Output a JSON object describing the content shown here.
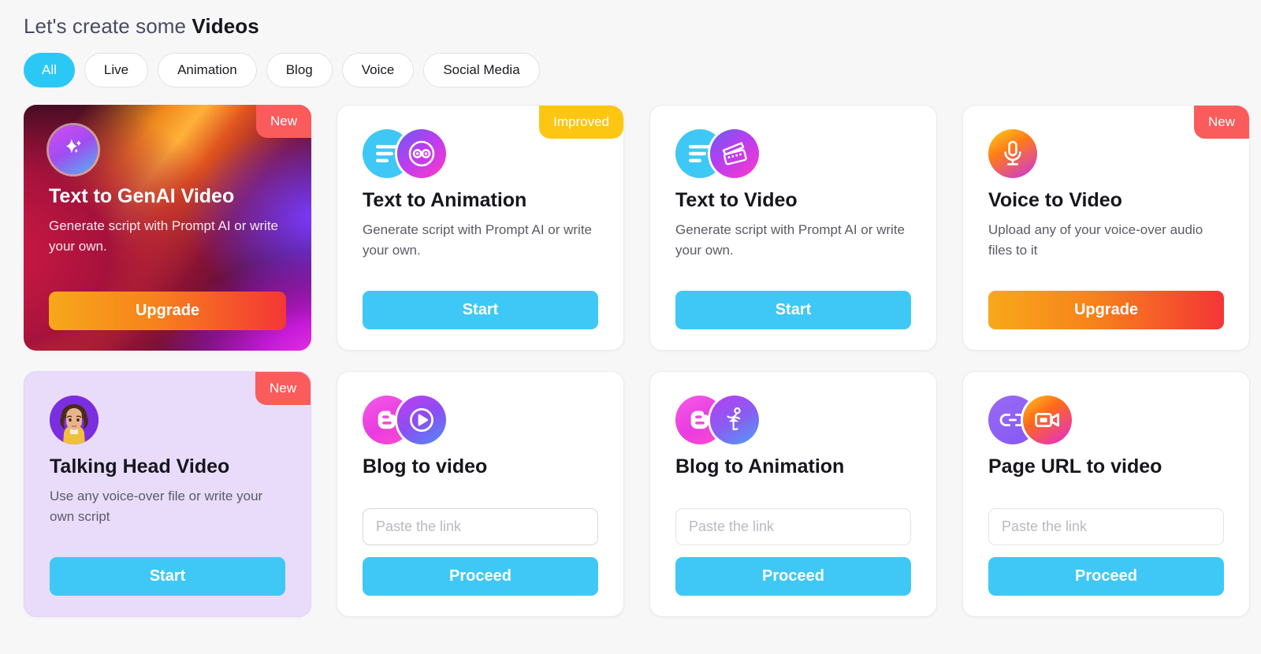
{
  "header": {
    "prefix": "Let's create some ",
    "highlight": "Videos"
  },
  "filters": [
    {
      "label": "All",
      "active": true
    },
    {
      "label": "Live",
      "active": false
    },
    {
      "label": "Animation",
      "active": false
    },
    {
      "label": "Blog",
      "active": false
    },
    {
      "label": "Voice",
      "active": false
    },
    {
      "label": "Social Media",
      "active": false
    }
  ],
  "colors": {
    "accent_blue": "#3fc8f5",
    "badge_new": "#fa5c5c",
    "badge_improved": "#fcc613",
    "upgrade_from": "#f7a81b",
    "upgrade_to": "#f43636",
    "page_background": "#f7f7f8",
    "lavender_card": "#e9dcfb"
  },
  "cards": [
    {
      "title": "Text to GenAI Video",
      "description": "Generate script with Prompt AI or write your own.",
      "badge": "New",
      "badge_type": "new",
      "cta_label": "Upgrade",
      "cta_type": "upgrade",
      "icons": [
        "sparkle-icon"
      ],
      "style": "genai"
    },
    {
      "title": "Text to Animation",
      "description": "Generate script with Prompt AI or write your own.",
      "badge": "Improved",
      "badge_type": "improved",
      "cta_label": "Start",
      "cta_type": "start",
      "icons": [
        "text-lines-icon",
        "goggles-face-icon"
      ],
      "style": "plain"
    },
    {
      "title": "Text to Video",
      "description": "Generate script with Prompt AI or write your own.",
      "badge": null,
      "badge_type": null,
      "cta_label": "Start",
      "cta_type": "start",
      "icons": [
        "text-lines-icon",
        "clapperboard-icon"
      ],
      "style": "plain"
    },
    {
      "title": "Voice to Video",
      "description": "Upload any of your voice-over audio files to it",
      "badge": "New",
      "badge_type": "new",
      "cta_label": "Upgrade",
      "cta_type": "upgrade",
      "icons": [
        "microphone-icon"
      ],
      "style": "plain"
    },
    {
      "title": "Talking Head Video",
      "description": "Use any voice-over file or write your own script",
      "badge": "New",
      "badge_type": "new",
      "cta_label": "Start",
      "cta_type": "start",
      "icons": [
        "avatar-woman-icon"
      ],
      "style": "lavender"
    },
    {
      "title": "Blog to video",
      "description": null,
      "badge": null,
      "badge_type": null,
      "input_placeholder": "Paste the link",
      "input_value": "",
      "input_focused": true,
      "cta_label": "Proceed",
      "cta_type": "start",
      "icons": [
        "blogger-icon",
        "play-icon"
      ],
      "style": "plain"
    },
    {
      "title": "Blog to Animation",
      "description": null,
      "badge": null,
      "badge_type": null,
      "input_placeholder": "Paste the link",
      "input_value": "",
      "input_focused": false,
      "cta_label": "Proceed",
      "cta_type": "start",
      "icons": [
        "blogger-icon",
        "dancer-icon"
      ],
      "style": "plain"
    },
    {
      "title": "Page URL to video",
      "description": null,
      "badge": null,
      "badge_type": null,
      "input_placeholder": "Paste the link",
      "input_value": "",
      "input_focused": false,
      "cta_label": "Proceed",
      "cta_type": "start",
      "icons": [
        "link-icon",
        "video-camera-icon"
      ],
      "style": "plain"
    }
  ]
}
